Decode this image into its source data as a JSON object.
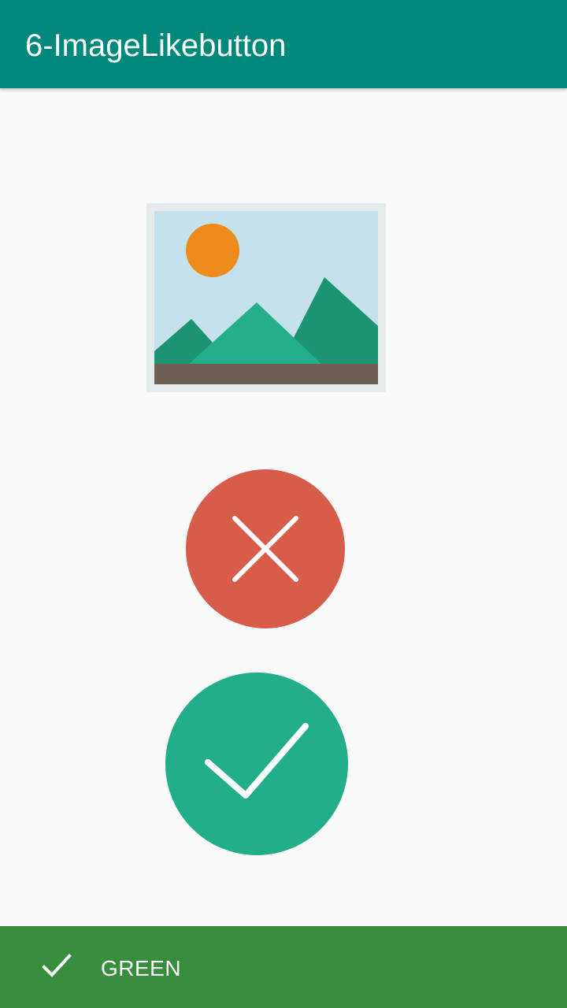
{
  "app_bar": {
    "title": "6-ImageLikebutton",
    "color": "#00897b"
  },
  "image_button": {
    "icon": "image-placeholder-icon"
  },
  "cancel_button": {
    "icon": "close-icon",
    "color": "#d85c4a"
  },
  "confirm_button": {
    "icon": "check-icon",
    "color": "#22ae88"
  },
  "snackbar": {
    "icon": "check-icon",
    "text": "GREEN",
    "color": "#388e3c"
  }
}
